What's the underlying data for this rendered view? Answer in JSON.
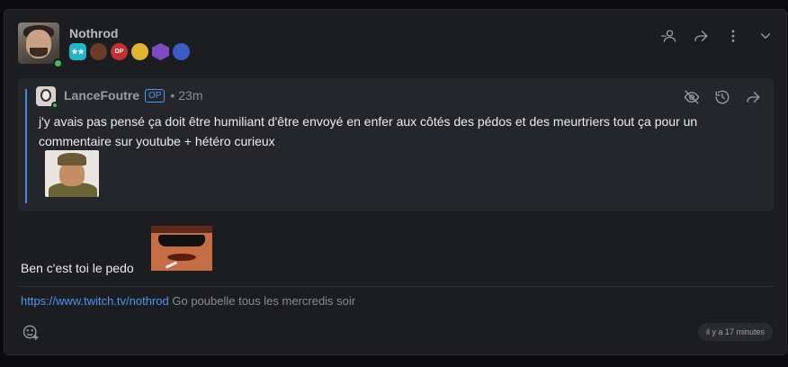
{
  "post": {
    "author": "Nothrod",
    "badges": [
      {
        "label": "★★",
        "icon": "stars-badge-icon"
      },
      {
        "label": "",
        "icon": "portrait-badge-icon"
      },
      {
        "label": "DP",
        "icon": "dp-badge-icon"
      },
      {
        "label": "",
        "icon": "emoji-badge-icon"
      },
      {
        "label": "",
        "icon": "hex-badge-icon"
      },
      {
        "label": "",
        "icon": "moon-badge-icon"
      }
    ],
    "message": "Ben c'est toi le pedo",
    "signature_link": "https://www.twitch.tv/nothrod",
    "signature_text": "Go poubelle tous les mercredis soir",
    "timestamp": "il y a 17 minutes"
  },
  "quote": {
    "author": "LanceFoutre",
    "op_label": "OP",
    "time": "• 23m",
    "text": "j'y avais pas pensé ça doit être humiliant d'être envoyé en enfer aux côtés des pédos et des meurtriers tout ça pour un commentaire sur youtube + hétéro curieux"
  },
  "colors": {
    "background": "#1c1d21",
    "quote_background": "#25262b",
    "accent": "#4c96f0",
    "online": "#3fb950"
  }
}
